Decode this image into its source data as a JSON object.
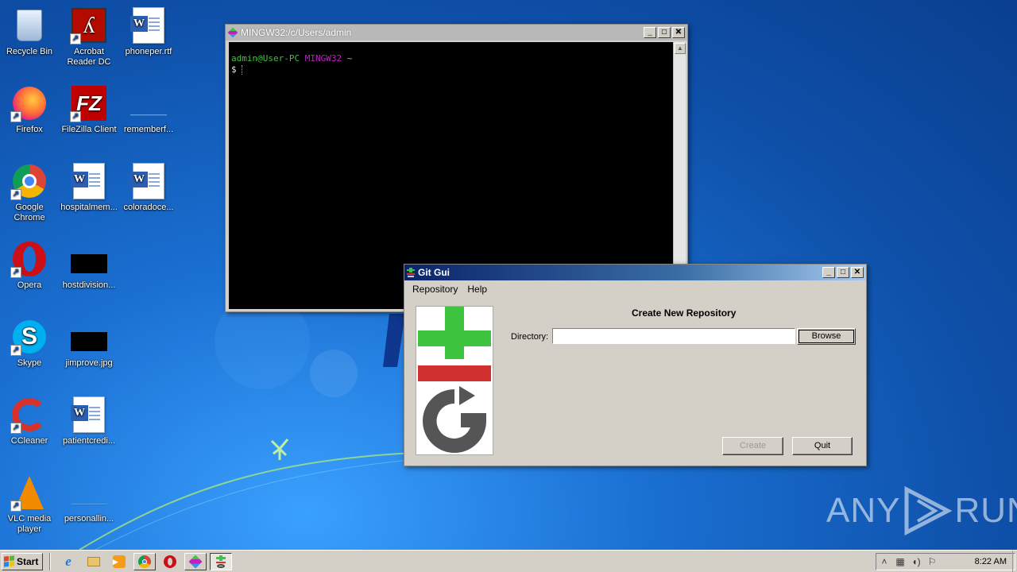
{
  "desktop": {
    "icons": [
      {
        "label": "Recycle Bin",
        "icon": "recycle-bin-icon"
      },
      {
        "label": "Acrobat\nReader DC",
        "icon": "acrobat-icon"
      },
      {
        "label": "phoneper.rtf",
        "icon": "word-doc-icon"
      },
      {
        "label": "Firefox",
        "icon": "firefox-icon"
      },
      {
        "label": "FileZilla Client",
        "icon": "filezilla-icon"
      },
      {
        "label": "rememberf...",
        "icon": "blank-file-icon"
      },
      {
        "label": "Google\nChrome",
        "icon": "chrome-icon"
      },
      {
        "label": "hospitalmem...",
        "icon": "word-doc-icon"
      },
      {
        "label": "coloradoce...",
        "icon": "word-doc-icon"
      },
      {
        "label": "Opera",
        "icon": "opera-icon"
      },
      {
        "label": "hostdivision...",
        "icon": "black-image-icon"
      },
      {
        "label": "Skype",
        "icon": "skype-icon"
      },
      {
        "label": "jimprove.jpg",
        "icon": "black-image-icon"
      },
      {
        "label": "CCleaner",
        "icon": "ccleaner-icon"
      },
      {
        "label": "patientcredi...",
        "icon": "word-doc-icon"
      },
      {
        "label": "VLC media\nplayer",
        "icon": "vlc-icon"
      },
      {
        "label": "personallin...",
        "icon": "blank-file-icon"
      }
    ]
  },
  "terminal": {
    "title": "MINGW32:/c/Users/admin",
    "prompt_user": "admin@User-PC",
    "prompt_env": "MINGW32",
    "prompt_path": "~",
    "prompt_symbol": "$"
  },
  "gitgui": {
    "title": "Git Gui",
    "menu": [
      "Repository",
      "Help"
    ],
    "heading": "Create New Repository",
    "directory_label": "Directory:",
    "directory_value": "",
    "browse_label": "Browse",
    "create_label": "Create",
    "quit_label": "Quit"
  },
  "taskbar": {
    "start_label": "Start",
    "clock": "8:22 AM"
  },
  "watermark": {
    "text_left": "ANY",
    "text_right": "RUN"
  },
  "colors": {
    "terminal_user": "#3ec43e",
    "terminal_env": "#c020c0",
    "terminal_path": "#c8b400",
    "gitgui_title_start": "#0a246a"
  }
}
